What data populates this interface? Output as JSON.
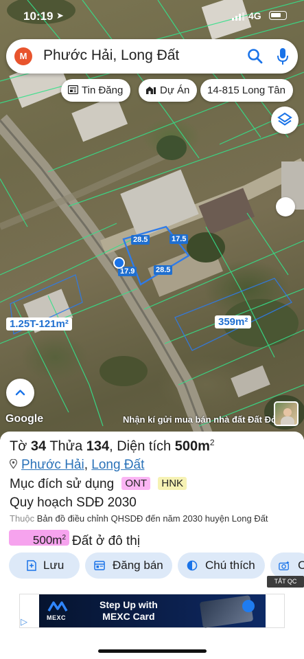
{
  "status_bar": {
    "time": "10:19",
    "network": "4G"
  },
  "search": {
    "avatar_letter": "M",
    "query": "Phước Hải, Long Đất",
    "icons": [
      "search-icon",
      "mic-icon"
    ]
  },
  "chips": [
    {
      "label": "Tin Đăng",
      "icon": "news-icon"
    },
    {
      "label": "Dự Án",
      "icon": "building-icon"
    },
    {
      "label": "14-815 Long Tân",
      "icon": ""
    }
  ],
  "map": {
    "dimensions": [
      "28.5",
      "17.5",
      "17.9",
      "28.5"
    ],
    "plot_labels": [
      "1.25T-121m²",
      "359m²"
    ],
    "attribution": "Google",
    "banner": "Nhận kí gửi mua bán nhà đất Đất Đỏ"
  },
  "panel": {
    "title_prefix": "Tờ ",
    "sheet": "34",
    "parcel_prefix": " Thửa ",
    "parcel": "134",
    "area_prefix": ", Diện tích ",
    "area": "500m",
    "area_sup": "2",
    "location_ward": "Phước Hải",
    "location_district": "Long Đất",
    "location_sep": ", ",
    "purpose_label": "Mục đích sử dụng",
    "purpose_tags": [
      "ONT",
      "HNK"
    ],
    "tag_colors": {
      "ONT": "#fbb5f4",
      "HNK": "#f6f2b4"
    },
    "plan_title": "Quy hoạch SDĐ 2030",
    "source_prefix": "Thuộc",
    "source_text": "Bản đồ điều chỉnh QHSDĐ đến năm 2030 huyện Long Đất",
    "plan_area": "500m",
    "plan_area_sup": "2",
    "plan_desc": "Đất ở đô thị"
  },
  "buttons": [
    {
      "label": "Lưu",
      "icon": "save-icon"
    },
    {
      "label": "Đăng bán",
      "icon": "listing-icon"
    },
    {
      "label": "Chú thích",
      "icon": "legend-icon"
    },
    {
      "label": "C",
      "icon": "camera-icon"
    }
  ],
  "ad": {
    "close_label": "TẮT QC",
    "brand": "MEXC",
    "headline_1": "Step Up with",
    "headline_2": "MEXC Card"
  },
  "colors": {
    "accent_blue": "#1f6fd0",
    "button_bg": "#dde9f8",
    "link": "#2a72b8",
    "avatar": "#e8542d"
  }
}
